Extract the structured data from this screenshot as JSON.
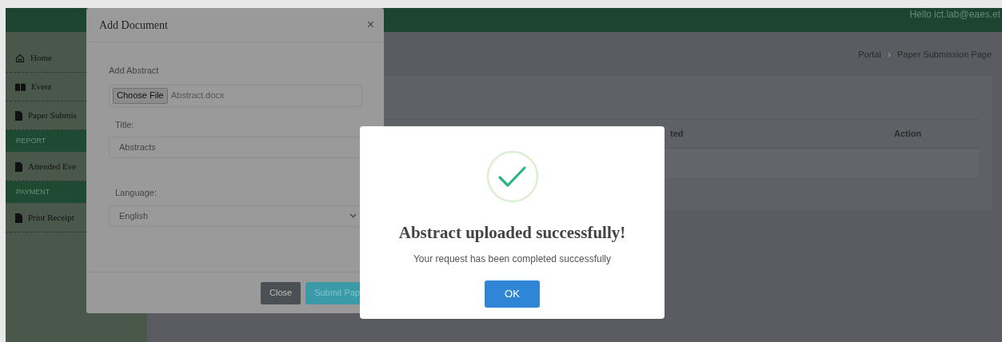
{
  "header": {
    "greeting": "Hello ict.lab@eaes.et"
  },
  "sidebar": {
    "items": [
      {
        "kind": "home",
        "label": "Home"
      },
      {
        "kind": "book",
        "label": "Event"
      },
      {
        "kind": "file",
        "label": "Paper Submis"
      },
      {
        "kind": "section",
        "label": "REPORT"
      },
      {
        "kind": "file",
        "label": "Attended Eve"
      },
      {
        "kind": "section",
        "label": "PAYMENT"
      },
      {
        "kind": "file",
        "label": "Print Receipt"
      }
    ]
  },
  "breadcrumb": {
    "items": [
      "Portal",
      "Paper Submission Page"
    ],
    "separator": "›"
  },
  "table": {
    "columns": [
      "ted",
      "Action"
    ]
  },
  "add_document_modal": {
    "title": "Add Document",
    "close": "×",
    "file_label": "Add Abstract",
    "file_button": "Choose File",
    "file_name": "Abstract.docx",
    "title_label": "Title:",
    "title_value": "Abstracts",
    "language_label": "Language:",
    "language_value": "English",
    "buttons": [
      "Close",
      "Submit Pap"
    ]
  },
  "success_dialog": {
    "title": "Abstract uploaded successfully!",
    "message": "Your request has been completed successfully",
    "button": "OK"
  }
}
